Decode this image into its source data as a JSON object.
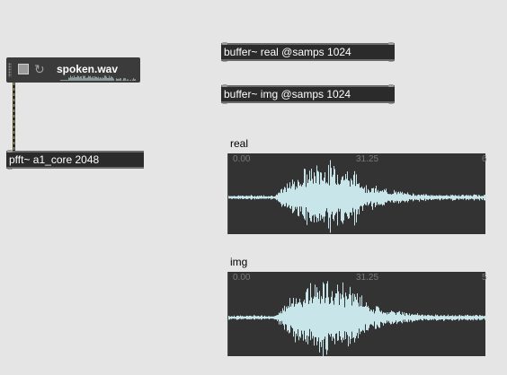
{
  "patch": {
    "sfplayer": {
      "filename": "spoken.wav",
      "loop_icon": "loop-icon",
      "stop_icon": "stop-square-icon"
    },
    "objects": {
      "pfft": "pfft~ a1_core 2048",
      "buffer_real": "buffer~ real @samps 1024",
      "buffer_img": "buffer~ img @samps 1024"
    },
    "waveforms": [
      {
        "label": "real",
        "ticks": [
          "0.00",
          "31.25",
          "6"
        ]
      },
      {
        "label": "img",
        "ticks": [
          "0.00",
          "31.25",
          "5"
        ]
      }
    ]
  },
  "colors": {
    "canvas_bg": "#e5e5e5",
    "object_bg": "#2b2b2b",
    "waveform_bg": "#333333",
    "waveform_line": "#c8e6ea",
    "patchcord": "#b0a24a"
  }
}
